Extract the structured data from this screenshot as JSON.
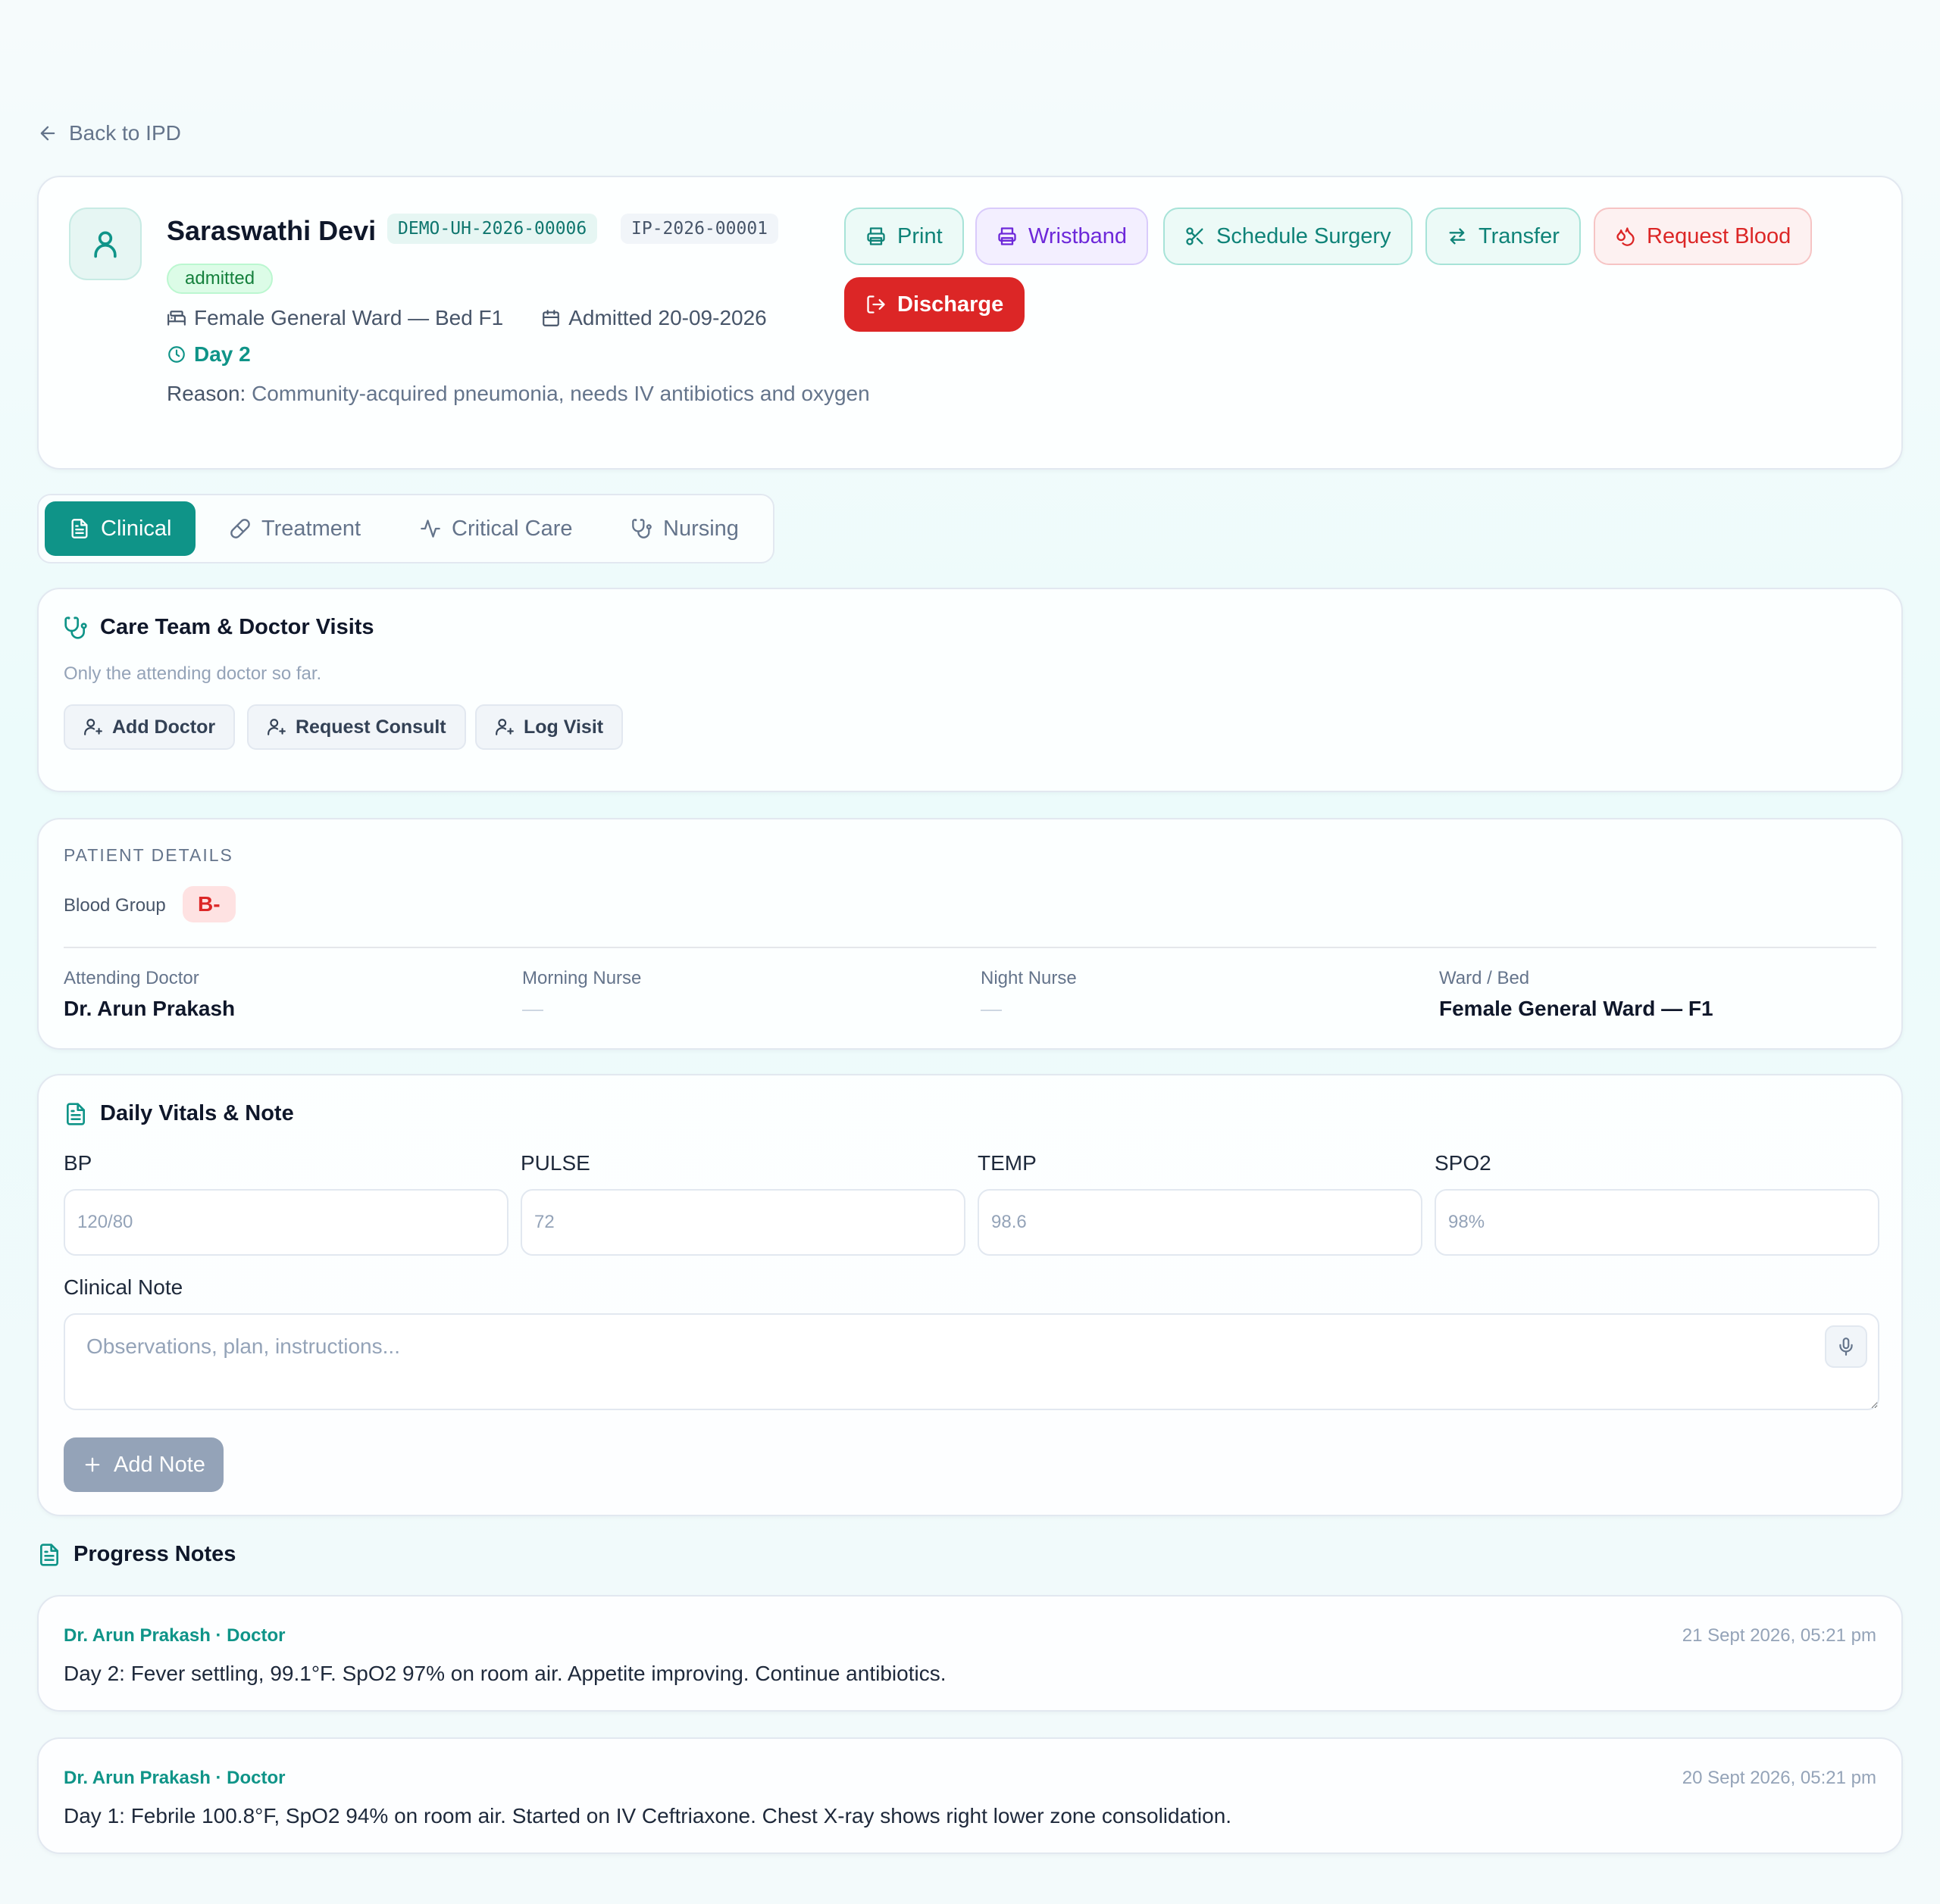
{
  "nav": {
    "back_label": "Back to IPD"
  },
  "patient": {
    "name": "Saraswathi Devi",
    "uhid": "DEMO-UH-2026-00006",
    "ipid": "IP-2026-00001",
    "status": "admitted",
    "ward_bed": "Female General Ward — Bed F1",
    "admitted": "Admitted 20-09-2026",
    "day": "Day 2",
    "reason_label": "Reason:",
    "reason_text": "Community-acquired pneumonia, needs IV antibiotics and oxygen"
  },
  "actions": {
    "print": "Print",
    "wristband": "Wristband",
    "schedule_surgery": "Schedule Surgery",
    "transfer": "Transfer",
    "request_blood": "Request Blood",
    "discharge": "Discharge"
  },
  "tabs": [
    {
      "label": "Clinical",
      "active": true
    },
    {
      "label": "Treatment"
    },
    {
      "label": "Critical Care"
    },
    {
      "label": "Nursing"
    }
  ],
  "care_team": {
    "title": "Care Team & Doctor Visits",
    "subtitle": "Only the attending doctor so far.",
    "add_doctor": "Add Doctor",
    "request_consult": "Request Consult",
    "log_visit": "Log Visit"
  },
  "patient_details": {
    "heading": "PATIENT DETAILS",
    "blood_group_label": "Blood Group",
    "blood_group": "B-",
    "fields": [
      {
        "label": "Attending Doctor",
        "value": "Dr. Arun Prakash"
      },
      {
        "label": "Morning Nurse",
        "value": "—"
      },
      {
        "label": "Night Nurse",
        "value": "—"
      },
      {
        "label": "Ward / Bed",
        "value": "Female General Ward — F1"
      }
    ]
  },
  "vitals": {
    "title": "Daily Vitals & Note",
    "fields": [
      {
        "label": "BP",
        "placeholder": "120/80"
      },
      {
        "label": "PULSE",
        "placeholder": "72"
      },
      {
        "label": "TEMP",
        "placeholder": "98.6"
      },
      {
        "label": "SPO2",
        "placeholder": "98%"
      }
    ],
    "note_label": "Clinical Note",
    "note_placeholder": "Observations, plan, instructions...",
    "add_note": "Add Note"
  },
  "progress_notes": {
    "title": "Progress Notes",
    "items": [
      {
        "author": "Dr. Arun Prakash · Doctor",
        "time": "21 Sept 2026, 05:21 pm",
        "text": "Day 2: Fever settling, 99.1°F. SpO2 97% on room air. Appetite improving. Continue antibiotics."
      },
      {
        "author": "Dr. Arun Prakash · Doctor",
        "time": "20 Sept 2026, 05:21 pm",
        "text": "Day 1: Febrile 100.8°F, SpO2 94% on room air. Started on IV Ceftriaxone. Chest X-ray shows right lower zone consolidation."
      }
    ]
  }
}
